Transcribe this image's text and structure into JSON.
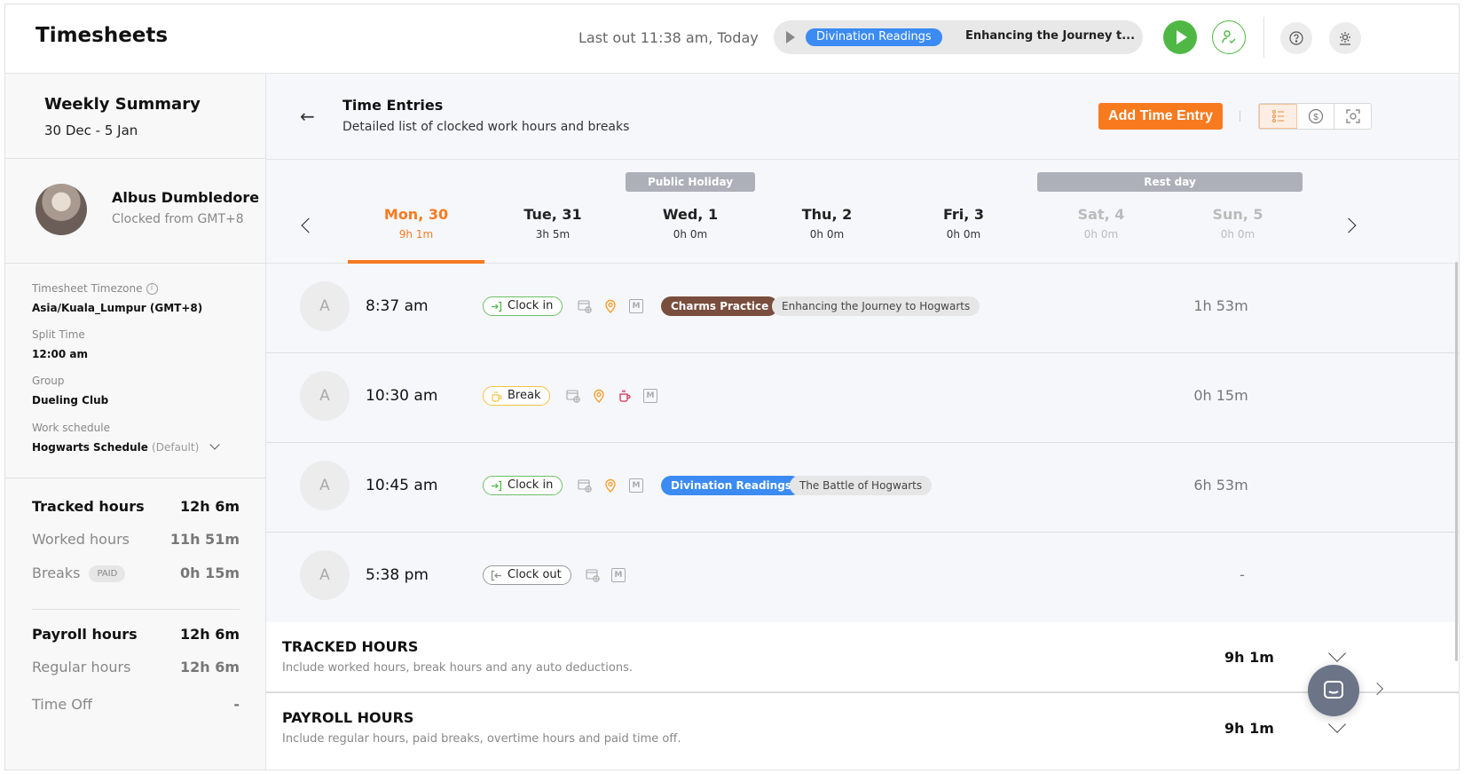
{
  "header": {
    "title": "Timesheets",
    "last_out": "Last out 11:38 am, Today",
    "current_activity": {
      "tag": "Divination Readings",
      "description": "Enhancing the Journey t..."
    },
    "icons": {
      "play": "play-icon",
      "start": "start-timer-icon",
      "user_check": "user-check-icon",
      "help": "help-icon",
      "settings": "settings-icon"
    }
  },
  "sidebar": {
    "weekly_summary_title": "Weekly Summary",
    "date_range": "30 Dec - 5 Jan",
    "employee": {
      "name": "Albus Dumbledore",
      "subtitle": "Clocked from GMT+8"
    },
    "info": [
      {
        "label": "Timesheet Timezone",
        "value": "Asia/Kuala_Lumpur (GMT+8)"
      },
      {
        "label": "Split Time",
        "value": "12:00 am"
      },
      {
        "label": "Group",
        "value": "Dueling Club"
      },
      {
        "label": "Work schedule",
        "value": "Hogwarts Schedule",
        "suffix": "(Default)"
      }
    ],
    "tracked": {
      "label": "Tracked hours",
      "value": "12h 6m"
    },
    "worked": {
      "label": "Worked hours",
      "value": "11h 51m"
    },
    "breaks": {
      "label": "Breaks",
      "badge": "PAID",
      "value": "0h 15m"
    },
    "payroll": {
      "label": "Payroll hours",
      "value": "12h 6m"
    },
    "regular": {
      "label": "Regular hours",
      "value": "12h 6m"
    },
    "time_off": {
      "label": "Time Off",
      "value": "-"
    }
  },
  "main": {
    "title": "Time Entries",
    "subtitle": "Detailed list of clocked work hours and breaks",
    "add_button": "Add Time Entry",
    "accent_color": "#f77a1f",
    "banners": {
      "public_holiday": "Public Holiday",
      "rest_day": "Rest day"
    },
    "days": [
      {
        "name": "Mon, 30",
        "hours": "9h 1m",
        "state": "selected"
      },
      {
        "name": "Tue, 31",
        "hours": "3h 5m",
        "state": "normal"
      },
      {
        "name": "Wed, 1",
        "hours": "0h 0m",
        "state": "holiday"
      },
      {
        "name": "Thu, 2",
        "hours": "0h 0m",
        "state": "normal"
      },
      {
        "name": "Fri, 3",
        "hours": "0h 0m",
        "state": "normal"
      },
      {
        "name": "Sat, 4",
        "hours": "0h 0m",
        "state": "rest"
      },
      {
        "name": "Sun, 5",
        "hours": "0h 0m",
        "state": "rest"
      }
    ],
    "entries": [
      {
        "avatar": "A",
        "time": "8:37 am",
        "type": "Clock in",
        "tag": "Charms Practice",
        "tag_color": "#7a4e3e",
        "note": "Enhancing the Journey to Hogwarts",
        "duration": "1h 53m"
      },
      {
        "avatar": "A",
        "time": "10:30 am",
        "type": "Break",
        "duration": "0h 15m"
      },
      {
        "avatar": "A",
        "time": "10:45 am",
        "type": "Clock in",
        "tag": "Divination Readings",
        "tag_color": "#3b8bf2",
        "note": "The Battle of Hogwarts",
        "duration": "6h 53m"
      },
      {
        "avatar": "A",
        "time": "5:38 pm",
        "type": "Clock out",
        "duration": "-"
      }
    ],
    "tracked_section": {
      "title": "TRACKED HOURS",
      "subtitle": "Include worked hours, break hours and any auto deductions.",
      "value": "9h 1m"
    },
    "payroll_section": {
      "title": "PAYROLL HOURS",
      "subtitle": "Include regular hours, paid breaks, overtime hours and paid time off.",
      "value": "9h 1m"
    }
  }
}
